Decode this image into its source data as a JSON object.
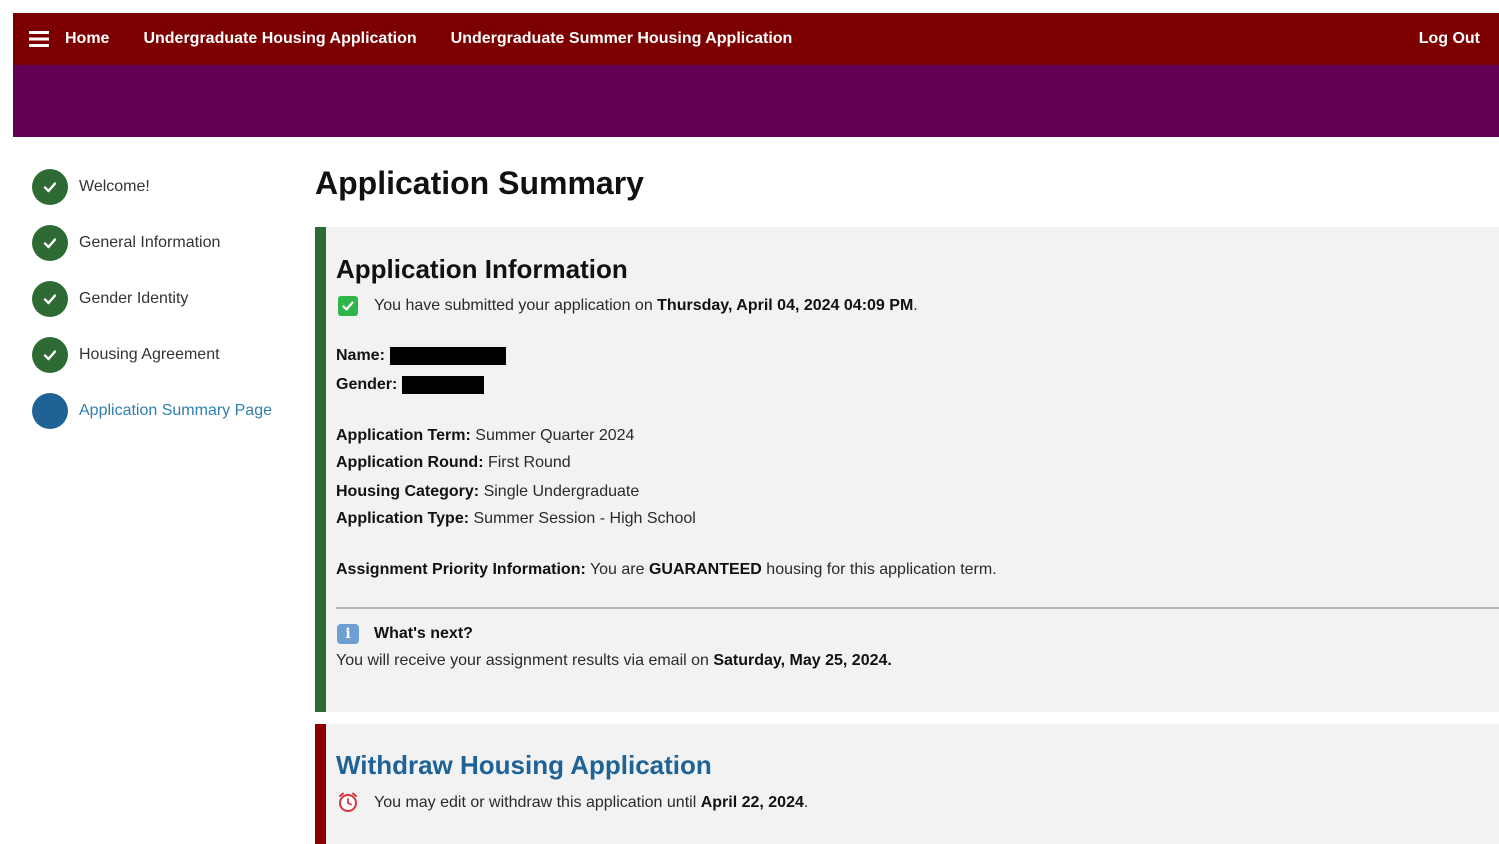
{
  "nav": {
    "home": "Home",
    "undergrad_app": "Undergraduate Housing Application",
    "summer_app": "Undergraduate Summer Housing Application",
    "logout": "Log Out"
  },
  "sidebar": {
    "steps": [
      {
        "label": "Welcome!",
        "status": "complete"
      },
      {
        "label": "General Information",
        "status": "complete"
      },
      {
        "label": "Gender Identity",
        "status": "complete"
      },
      {
        "label": "Housing Agreement",
        "status": "complete"
      },
      {
        "label": "Application Summary Page",
        "status": "current"
      }
    ]
  },
  "page": {
    "title": "Application Summary"
  },
  "info": {
    "title": "Application Information",
    "submitted_prefix": "You have submitted your application on ",
    "submitted_date": "Thursday, April 04, 2024 04:09 PM",
    "submitted_suffix": ".",
    "name_label": "Name:",
    "gender_label": "Gender:",
    "term_label": "Application Term:",
    "term_value": " Summer Quarter 2024",
    "round_label": "Application Round:",
    "round_value": " First Round",
    "category_label": "Housing Category:",
    "category_value": " Single Undergraduate",
    "type_label": "Application Type:",
    "type_value": " Summer Session - High School",
    "priority_label": "Assignment Priority Information:",
    "priority_prefix": " You are ",
    "priority_strong": "GUARANTEED",
    "priority_suffix": " housing for this application term.",
    "next_title": "What's next?",
    "next_prefix": "You will receive your assignment results via email on ",
    "next_date": "Saturday, May 25, 2024.",
    "info_icon_glyph": "i"
  },
  "withdraw": {
    "title": "Withdraw Housing Application",
    "text_prefix": "You may edit or withdraw this application until ",
    "deadline": "April 22, 2024",
    "text_suffix": "."
  },
  "colors": {
    "nav_bg": "#7d0000",
    "band_bg": "#630054",
    "complete_green": "#2e6b34",
    "current_blue": "#1f6396",
    "withdraw_red": "#8a0000"
  }
}
